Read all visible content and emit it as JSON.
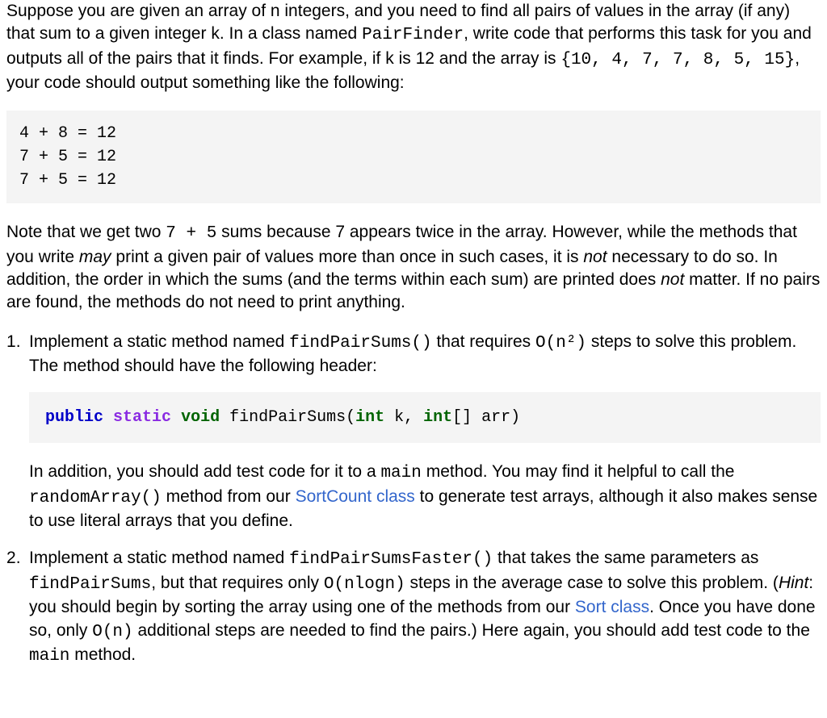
{
  "intro": {
    "part1": "Suppose you are given an array of n integers, and you need to find all pairs of values in the array (if any) that sum to a given integer k. In a class named ",
    "class_name": "PairFinder",
    "part2": ", write code that performs this task for you and outputs all of the pairs that it finds. For example, if k is 12 and the array is ",
    "array_literal": "{10, 4, 7, 7, 8, 5, 15}",
    "part3": ", your code should output something like the following:"
  },
  "example_output": "4 + 8 = 12\n7 + 5 = 12\n7 + 5 = 12",
  "note": {
    "p1": "Note that we get two ",
    "sum_expr": "7 + 5",
    "p2": " sums because 7 appears twice in the array. However, while the methods that you write ",
    "may": "may",
    "p3": " print a given pair of values more than once in such cases, it is ",
    "not1": "not",
    "p4": " necessary to do so. In addition, the order in which the sums (and the terms within each sum) are printed does ",
    "not2": "not",
    "p5": " matter. If no pairs are found, the methods do not need to print anything."
  },
  "item1": {
    "p1a": "Implement a static method named ",
    "method": "findPairSums()",
    "p1b": " that requires ",
    "bigO": "O(n²)",
    "p1c": " steps to solve this problem. The method should have the following header:",
    "sig": {
      "kw_public": "public",
      "kw_static": "static",
      "kw_void": "void",
      "name": "findPairSums(",
      "kw_int1": "int",
      "arg1": " k, ",
      "kw_int2": "int",
      "arg2": "[] arr)"
    },
    "p2a": "In addition, you should add test code for it to a ",
    "main": "main",
    "p2b": " method. You may find it helpful to call the ",
    "random_array": "randomArray()",
    "p2c": " method from our ",
    "sortcount_link": "SortCount class",
    "p2d": " to generate test arrays, although it also makes sense to use literal arrays that you define."
  },
  "item2": {
    "p1a": "Implement a static method named ",
    "method": "findPairSumsFaster()",
    "p1b": " that takes the same parameters as ",
    "method2": "findPairSums",
    "p1c": ", but that requires only ",
    "bigO": "O(nlogn)",
    "p1d": " steps in the average case to solve this problem. (",
    "hint_label": "Hint",
    "p1e": ": you should begin by sorting the array using one of the methods from our ",
    "sort_link": "Sort class",
    "p1f": ". Once you have done so, only ",
    "bigO2": "O(n)",
    "p1g": " additional steps are needed to find the pairs.) Here again, you should add test code to the ",
    "main": "main",
    "p1h": " method."
  }
}
